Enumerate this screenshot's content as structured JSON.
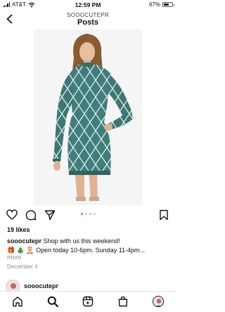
{
  "status_bar": {
    "carrier": "AT&T",
    "time": "12:59 PM",
    "battery": "67%",
    "battery_level": 0.67
  },
  "header": {
    "username": "SOOOCUTEPR",
    "title": "Posts"
  },
  "post": {
    "image_alt": "Woman wearing a teal sweater dress with white diamond lattice pattern",
    "carousel": {
      "count": 4,
      "active_index": 0
    },
    "likes": "19 likes",
    "caption_user": "sooocutepr",
    "caption_text": " Shop with us this weekend!",
    "caption_line2": "🎁 🎄 🤶 Open today 10-6pm. Sunday 11-4pm...",
    "more_label": "more",
    "date": "December 4"
  },
  "next_post": {
    "username": "sooocutepr"
  },
  "icons": {
    "back": "chevron-left-icon",
    "like": "heart-icon",
    "comment": "comment-icon",
    "share": "send-icon",
    "save": "bookmark-icon"
  },
  "colors": {
    "carousel_active": "#3897f0",
    "dress": "#3f7e7c"
  }
}
